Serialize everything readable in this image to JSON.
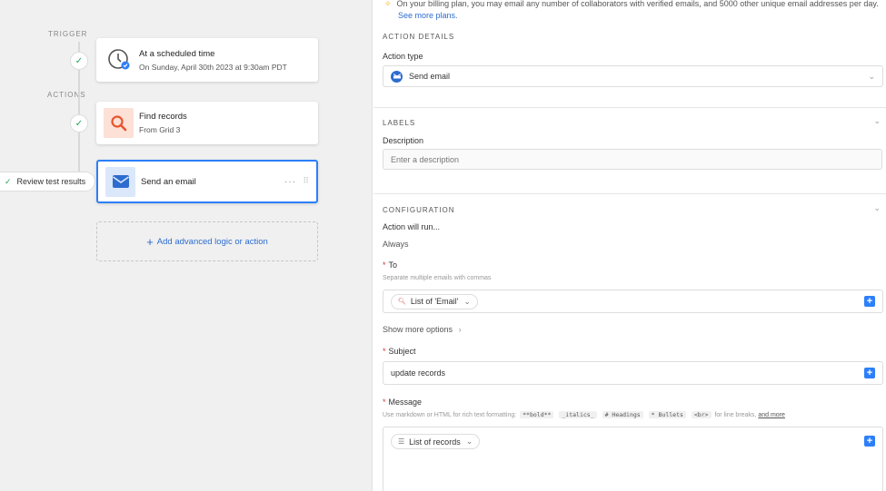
{
  "canvas": {
    "trigger_label": "TRIGGER",
    "actions_label": "ACTIONS",
    "trigger_card": {
      "title": "At a scheduled time",
      "subtitle": "On Sunday, April 30th 2023 at 9:30am PDT"
    },
    "find_card": {
      "title": "Find records",
      "subtitle": "From Grid 3"
    },
    "email_card": {
      "title": "Send an email",
      "more": "···",
      "grip": "⠿"
    },
    "review_pill": "Review test results",
    "add_logic": "Add advanced logic or action"
  },
  "panel": {
    "billing_text": "On your billing plan, you may email any number of collaborators with verified emails, and 5000 other unique email addresses per day.",
    "billing_link": "See more plans.",
    "action_details_head": "ACTION DETAILS",
    "action_type_label": "Action type",
    "action_type_value": "Send email",
    "labels_head": "LABELS",
    "description_label": "Description",
    "description_placeholder": "Enter a description",
    "config_head": "CONFIGURATION",
    "will_run_label": "Action will run...",
    "will_run_value": "Always",
    "to_label": "To",
    "to_hint": "Separate multiple emails with commas",
    "to_pill": "List of 'Email'",
    "show_more": "Show more options",
    "subject_label": "Subject",
    "subject_value": "update records",
    "message_label": "Message",
    "message_hint_pre": "Use markdown or HTML for rich text formatting:",
    "message_codes": [
      "**bold**",
      "_italics_",
      "# Headings",
      "* Bullets",
      "<br>"
    ],
    "message_hint_mid": "for line breaks,",
    "message_hint_link": "and more",
    "message_pill": "List of records",
    "required_mark": "*"
  },
  "colors": {
    "accent": "#2d7ff9",
    "success": "#20a35a",
    "find_icon_bg": "#fde0d6",
    "email_icon_bg": "#dbe7fb"
  },
  "icons": {
    "trigger": "clock-icon",
    "find": "search-icon",
    "email": "envelope-icon"
  }
}
